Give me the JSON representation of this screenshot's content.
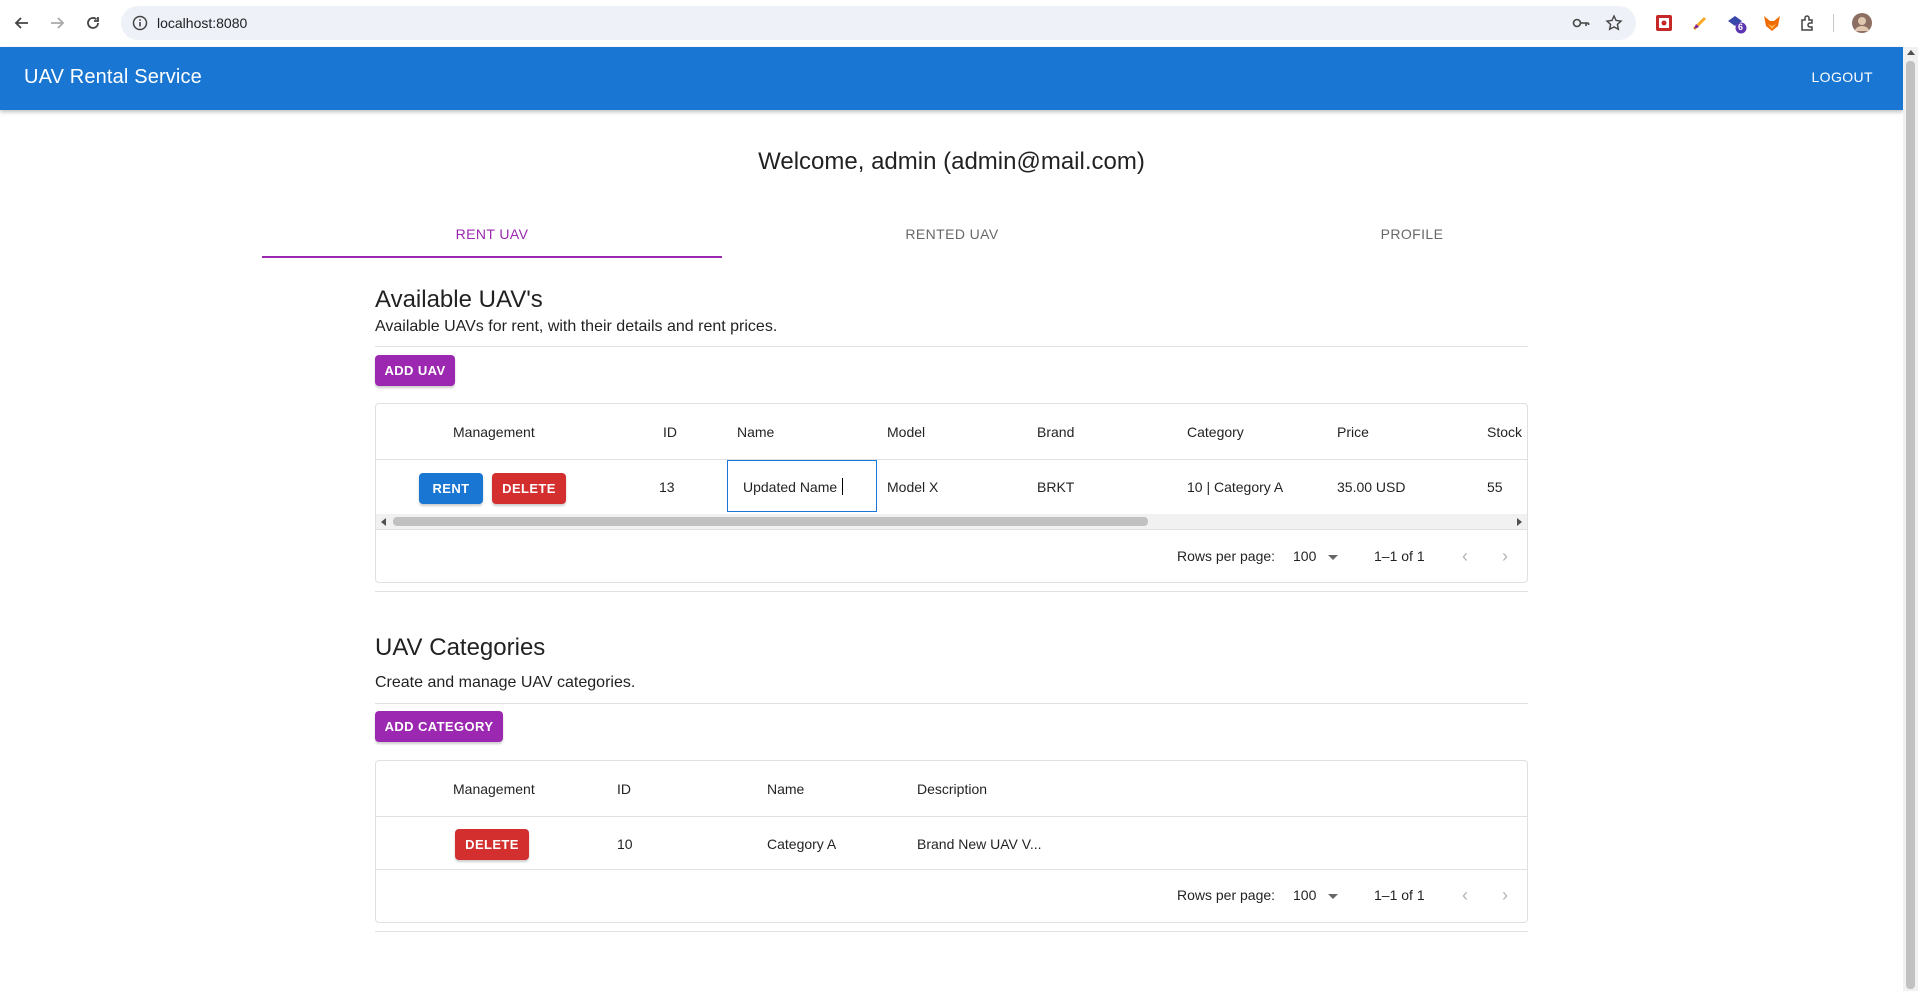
{
  "browser": {
    "url": "localhost:8080",
    "extension_badge": "6"
  },
  "appbar": {
    "title": "UAV Rental Service",
    "logout_label": "LOGOUT"
  },
  "welcome": "Welcome, admin (admin@mail.com)",
  "tabs": [
    {
      "label": "RENT UAV",
      "active": true
    },
    {
      "label": "RENTED UAV",
      "active": false
    },
    {
      "label": "PROFILE",
      "active": false
    }
  ],
  "uavs": {
    "title": "Available UAV's",
    "subtitle": "Available UAVs for rent, with their details and rent prices.",
    "add_label": "ADD UAV",
    "columns": [
      "Management",
      "ID",
      "Name",
      "Model",
      "Brand",
      "Category",
      "Price",
      "Stock"
    ],
    "rows": [
      {
        "rent_label": "RENT",
        "delete_label": "DELETE",
        "id": "13",
        "name": "Updated Name",
        "model": "Model X",
        "brand": "BRKT",
        "category": "10 | Category A",
        "price": "35.00 USD",
        "stock": "55"
      }
    ],
    "rows_per_page_label": "Rows per page:",
    "rows_per_page": "100",
    "range": "1–1 of 1"
  },
  "categories": {
    "title": "UAV Categories",
    "subtitle": "Create and manage UAV categories.",
    "add_label": "ADD CATEGORY",
    "columns": [
      "Management",
      "ID",
      "Name",
      "Description"
    ],
    "rows": [
      {
        "delete_label": "DELETE",
        "id": "10",
        "name": "Category A",
        "description": "Brand New UAV V..."
      }
    ],
    "rows_per_page_label": "Rows per page:",
    "rows_per_page": "100",
    "range": "1–1 of 1"
  },
  "colors": {
    "primary": "#1976d2",
    "secondary": "#9c27b0",
    "error": "#d32f2f"
  }
}
